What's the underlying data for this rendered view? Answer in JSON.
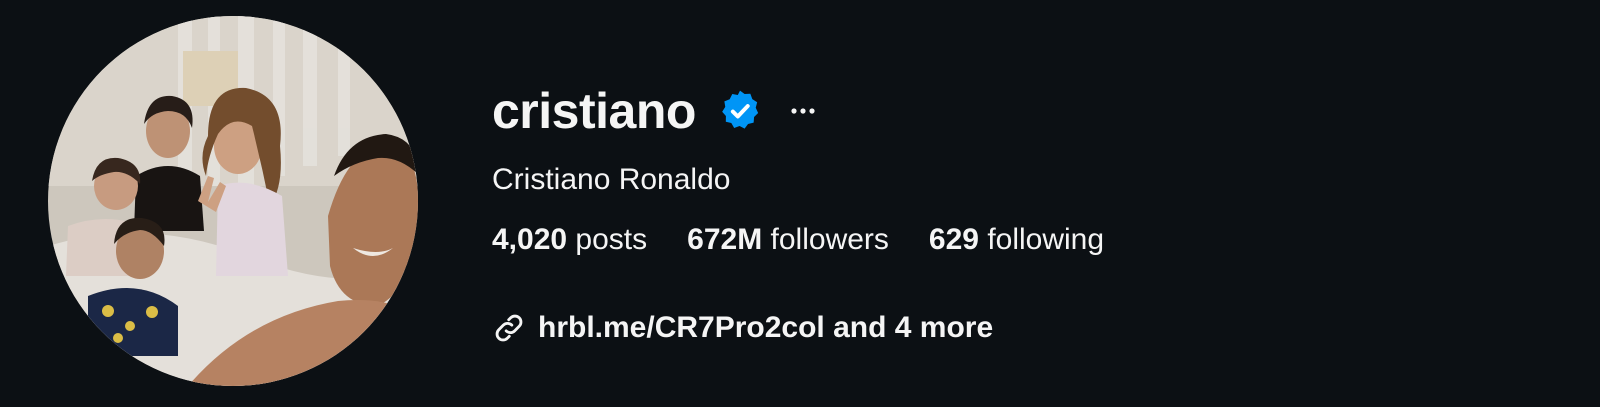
{
  "profile": {
    "username": "cristiano",
    "full_name": "Cristiano Ronaldo",
    "verified": true,
    "stats": {
      "posts": {
        "value": "4,020",
        "label": "posts"
      },
      "followers": {
        "value": "672M",
        "label": "followers"
      },
      "following": {
        "value": "629",
        "label": "following"
      }
    },
    "link": {
      "text": "hrbl.me/CR7Pro2col and 4 more"
    }
  },
  "colors": {
    "background": "#0c1014",
    "text": "#f5f5f5",
    "verified_badge": "#0095f6"
  },
  "icons": {
    "verified": "verified-badge-icon",
    "more": "more-options-icon",
    "link": "link-icon"
  }
}
